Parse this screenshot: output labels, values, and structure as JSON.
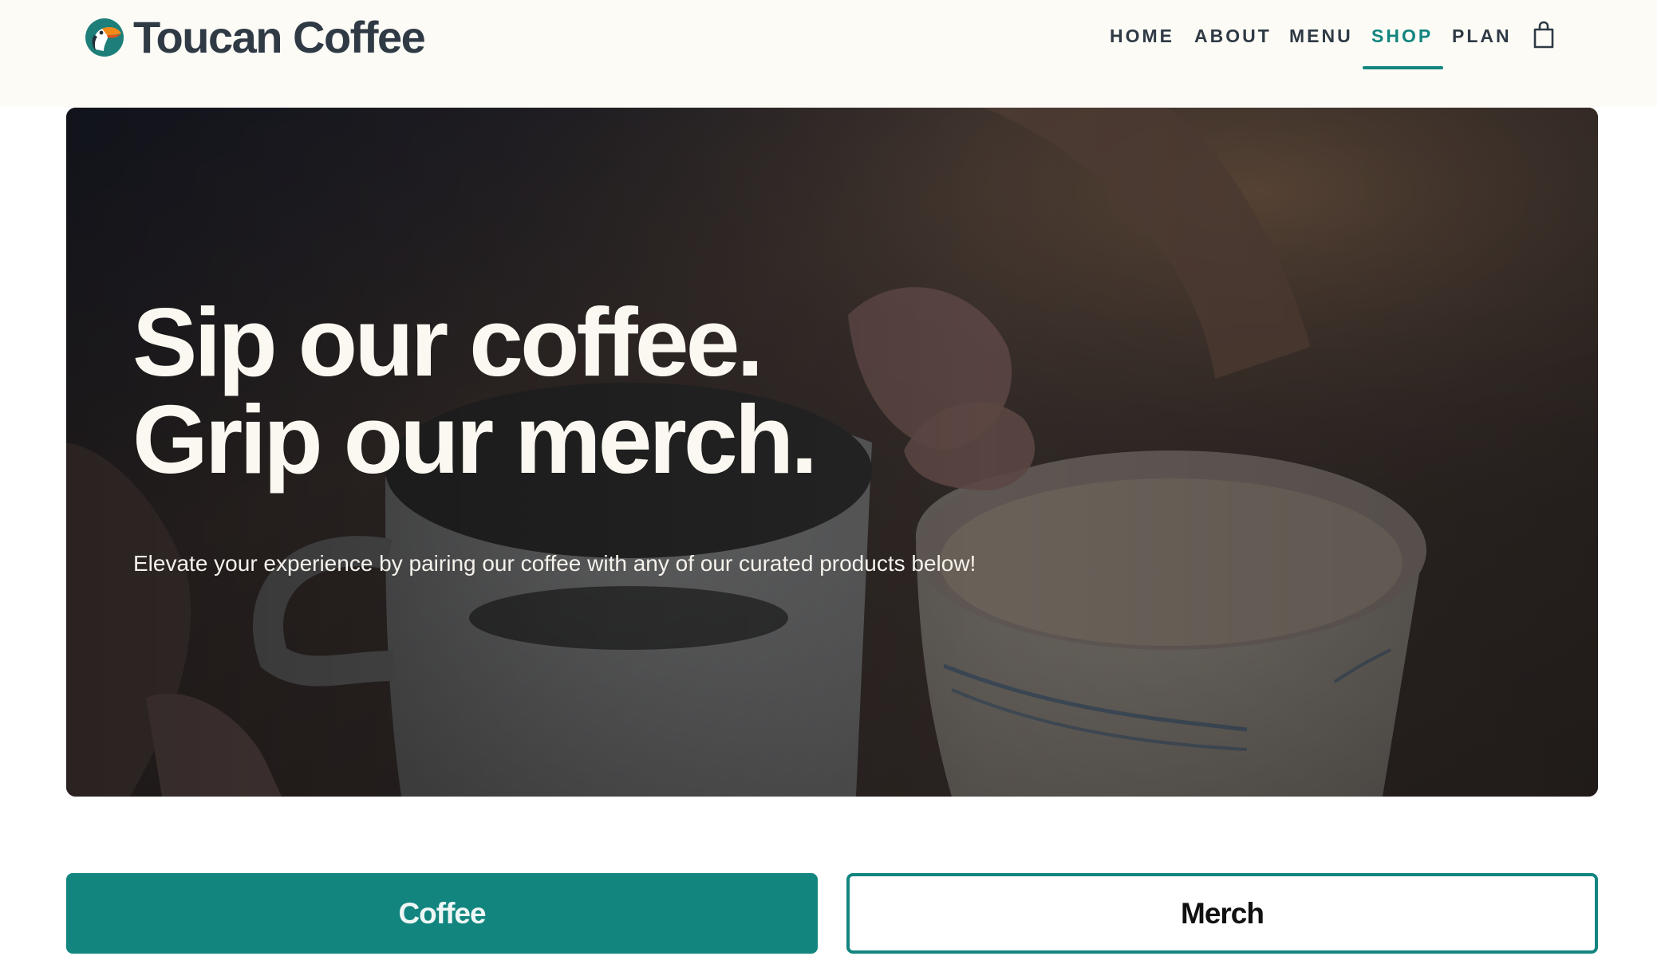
{
  "header": {
    "brand_name": "Toucan Coffee",
    "logo_icon": "toucan-logo-icon",
    "nav": [
      {
        "label": "HOME",
        "active": false
      },
      {
        "label": "ABOUT",
        "active": false
      },
      {
        "label": "MENU",
        "active": false
      },
      {
        "label": "SHOP",
        "active": true
      },
      {
        "label": "PLAN",
        "active": false
      }
    ],
    "cart_icon": "shopping-bag-icon"
  },
  "hero": {
    "title_line1": "Sip our coffee.",
    "title_line2": "Grip our merch.",
    "subtitle": "Elevate your experience by pairing our coffee with any of our curated products below!",
    "image": "two-coffee-cups-toasting-photo"
  },
  "categories": {
    "coffee_label": "Coffee",
    "merch_label": "Merch",
    "selected": "Coffee"
  },
  "colors": {
    "accent": "#12857f",
    "header_bg": "#fcfbf6",
    "text_dark": "#2f3a45",
    "hero_text": "#fbf8f1"
  }
}
